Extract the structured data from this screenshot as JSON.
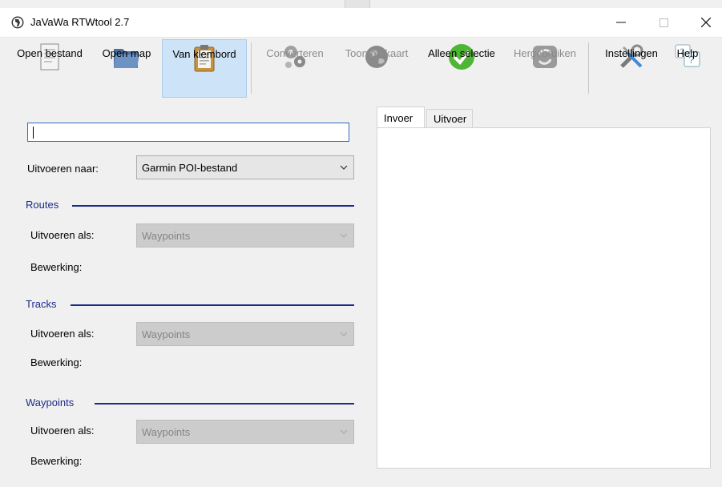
{
  "window": {
    "title": "JaVaWa RTWtool 2.7"
  },
  "toolbar": {
    "buttons": [
      {
        "label": "Open bestand",
        "icon": "document-icon",
        "enabled": true
      },
      {
        "label": "Open map",
        "icon": "folder-icon",
        "enabled": true
      },
      {
        "label": "Van klembord",
        "icon": "clipboard-icon",
        "enabled": true,
        "active": true
      },
      {
        "label": "Converteren",
        "icon": "gears-icon",
        "enabled": false
      },
      {
        "label": "Toon op kaart",
        "icon": "globe-icon",
        "enabled": false
      },
      {
        "label": "Alleen selectie",
        "icon": "checkmark-icon",
        "enabled": true
      },
      {
        "label": "Hergebruiken",
        "icon": "refresh-icon",
        "enabled": false
      },
      {
        "label": "Instellingen",
        "icon": "tools-icon",
        "enabled": true
      },
      {
        "label": "Help",
        "icon": "help-icon",
        "enabled": true
      }
    ]
  },
  "form": {
    "input_value": "",
    "output_to_label": "Uitvoeren naar:",
    "output_to_value": "Garmin POI-bestand",
    "sections": [
      {
        "title": "Routes",
        "output_as_label": "Uitvoeren als:",
        "output_as_value": "Waypoints",
        "edit_label": "Bewerking:"
      },
      {
        "title": "Tracks",
        "output_as_label": "Uitvoeren als:",
        "output_as_value": "Waypoints",
        "edit_label": "Bewerking:"
      },
      {
        "title": "Waypoints",
        "output_as_label": "Uitvoeren als:",
        "output_as_value": "Waypoints",
        "edit_label": "Bewerking:"
      }
    ]
  },
  "tabs": [
    {
      "label": "Invoer",
      "active": true
    },
    {
      "label": "Uitvoer",
      "active": false
    }
  ],
  "colors": {
    "section_title": "#1d2a8a",
    "active_button_bg": "#cde3f7",
    "accent_input_border": "#2e6fbf"
  }
}
